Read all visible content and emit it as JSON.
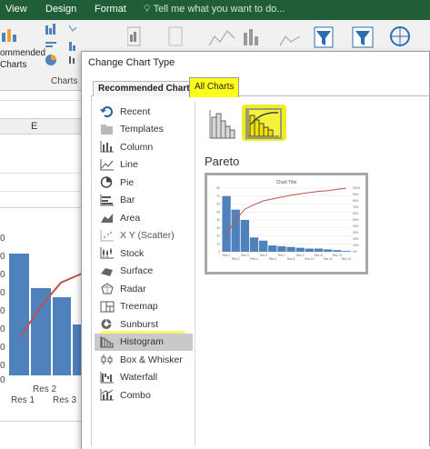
{
  "ribbon": {
    "tabs": [
      "View",
      "Design",
      "Format"
    ],
    "tell_me": "Tell me what you want to do...",
    "recommended_charts_label": "ommended\nCharts",
    "charts_group_label": "Charts"
  },
  "worksheet": {
    "column_header": "E",
    "y_tick_fragments": [
      "0",
      "0",
      "0",
      "0",
      "0",
      "0",
      "0",
      "0",
      "0"
    ],
    "x_labels_row1": [
      "Res 2"
    ],
    "x_labels_row2": [
      "Res 1",
      "Res 3"
    ]
  },
  "dialog": {
    "title": "Change Chart Type",
    "tabs": {
      "recommended": "Recommended Charts",
      "all": "All Charts"
    },
    "chart_types": [
      {
        "label": "Recent",
        "icon": "recent-icon"
      },
      {
        "label": "Templates",
        "icon": "templates-icon"
      },
      {
        "label": "Column",
        "icon": "column-chart-icon"
      },
      {
        "label": "Line",
        "icon": "line-chart-icon"
      },
      {
        "label": "Pie",
        "icon": "pie-chart-icon"
      },
      {
        "label": "Bar",
        "icon": "bar-chart-icon"
      },
      {
        "label": "Area",
        "icon": "area-chart-icon"
      },
      {
        "label": "X Y (Scatter)",
        "icon": "scatter-chart-icon"
      },
      {
        "label": "Stock",
        "icon": "stock-chart-icon"
      },
      {
        "label": "Surface",
        "icon": "surface-chart-icon"
      },
      {
        "label": "Radar",
        "icon": "radar-chart-icon"
      },
      {
        "label": "Treemap",
        "icon": "treemap-chart-icon"
      },
      {
        "label": "Sunburst",
        "icon": "sunburst-chart-icon"
      },
      {
        "label": "Histogram",
        "icon": "histogram-chart-icon"
      },
      {
        "label": "Box & Whisker",
        "icon": "box-whisker-chart-icon"
      },
      {
        "label": "Waterfall",
        "icon": "waterfall-chart-icon"
      },
      {
        "label": "Combo",
        "icon": "combo-chart-icon"
      }
    ],
    "selected_type_index": 13,
    "subtypes": [
      {
        "name": "histogram-subtype",
        "icon": "histogram-subtype-icon"
      },
      {
        "name": "pareto-subtype",
        "icon": "pareto-subtype-icon",
        "selected": true
      }
    ],
    "selected_subtype_name": "Pareto",
    "preview": {
      "title": "Chart Title",
      "x_labels_row1": [
        "Res 1",
        "Res 3",
        "Res 5",
        "Res 7",
        "Res 9",
        "Res 11",
        "Res 13"
      ],
      "x_labels_row2": [
        "Res 2",
        "Res 4",
        "Res 6",
        "Res 8",
        "Res 10",
        "Res 12",
        "Res 14"
      ],
      "y_left_ticks": [
        "80",
        "70",
        "60",
        "50",
        "40",
        "30",
        "20",
        "10",
        "0"
      ],
      "y_right_ticks": [
        "100%",
        "90%",
        "80%",
        "70%",
        "60%",
        "50%",
        "40%",
        "30%",
        "20%",
        "10%",
        "0%"
      ],
      "bar_values": [
        70,
        53,
        40,
        18,
        14,
        8,
        7,
        6,
        5,
        4,
        4,
        3,
        2,
        1
      ],
      "cumulative_pct": [
        29,
        50,
        67,
        74,
        80,
        83,
        86,
        89,
        91,
        93,
        95,
        96,
        98,
        100
      ]
    }
  },
  "colors": {
    "ribbon_green": "#1f5e36",
    "highlight_yellow": "#ffff1e",
    "bar_blue": "#4f81bd",
    "line_red": "#c0504d"
  }
}
